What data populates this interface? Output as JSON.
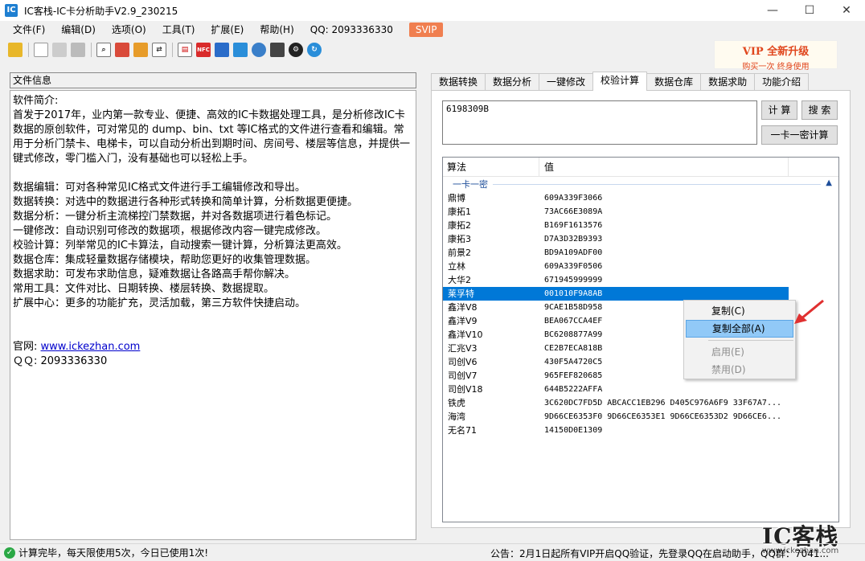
{
  "window": {
    "title": "IC客栈-IC卡分析助手V2.9_230215",
    "minimize": "—",
    "maximize": "☐",
    "close": "✕"
  },
  "menu": {
    "items": [
      "文件(F)",
      "编辑(D)",
      "选项(O)",
      "工具(T)",
      "扩展(E)",
      "帮助(H)"
    ],
    "qq": "QQ:  2093336330",
    "svip": "SVIP"
  },
  "vip_banner": {
    "line1": "VIP  全新升级",
    "line2": "购买一次      终身使用"
  },
  "left": {
    "header": "文件信息",
    "paragraphs": [
      "软件简介:",
      "首发于2017年，业内第一款专业、便捷、高效的IC卡数据处理工具，是分析修改IC卡数据的原创软件，可对常见的 dump、bin、txt 等IC格式的文件进行查看和编辑。常用于分析门禁卡、电梯卡，可以自动分析出到期时间、房间号、楼层等信息，并提供一键式修改，零门槛入门，没有基础也可以轻松上手。",
      "",
      "数据编辑：可对各种常见IC格式文件进行手工编辑修改和导出。",
      "数据转换：对选中的数据进行各种形式转换和简单计算，分析数据更便捷。",
      "数据分析：一键分析主流梯控门禁数据，并对各数据项进行着色标记。",
      "一键修改：自动识别可修改的数据项，根据修改内容一键完成修改。",
      "校验计算：列举常见的IC卡算法，自动搜索一键计算，分析算法更高效。",
      "数据仓库：集成轻量数据存储模块，帮助您更好的收集管理数据。",
      "数据求助：可发布求助信息，疑难数据让各路高手帮你解决。",
      "常用工具：文件对比、日期转换、楼层转换、数据提取。",
      "扩展中心：更多的功能扩充，灵活加载，第三方软件快捷启动。",
      "",
      ""
    ],
    "website_label": "官网: ",
    "website_url": "www.ickezhan.com",
    "qq_line": "ＱＱ: 2093336330"
  },
  "tabs": [
    "数据转换",
    "数据分析",
    "一键修改",
    "校验计算",
    "数据仓库",
    "数据求助",
    "功能介绍"
  ],
  "active_tab": 3,
  "calc": {
    "input_value": "6198309B",
    "btn_calc": "计 算",
    "btn_search": "搜 索",
    "btn_onecard": "一卡一密计算"
  },
  "results": {
    "col_algo": "算法",
    "col_value": "值",
    "group": "一卡一密",
    "rows": [
      {
        "name": "鼎博",
        "value": "609A339F3066"
      },
      {
        "name": "康拓1",
        "value": "73AC66E3089A"
      },
      {
        "name": "康拓2",
        "value": "B169F1613576"
      },
      {
        "name": "康拓3",
        "value": "D7A3D32B9393"
      },
      {
        "name": "前景2",
        "value": "BD9A109ADF00"
      },
      {
        "name": "立林",
        "value": "609A339F0506"
      },
      {
        "name": "大华2",
        "value": "671945999999"
      },
      {
        "name": "莱孚特",
        "value": "001010F9A8AB"
      },
      {
        "name": "鑫洋V8",
        "value": "9CAE1B58D958"
      },
      {
        "name": "鑫洋V9",
        "value": "BEA067CCA4EF"
      },
      {
        "name": "鑫洋V10",
        "value": "BC6208877A99"
      },
      {
        "name": "汇兆V3",
        "value": "CE2B7ECA818B"
      },
      {
        "name": "司创V6",
        "value": "430F5A4720C5"
      },
      {
        "name": "司创V7",
        "value": "965FEF820685"
      },
      {
        "name": "司创V18",
        "value": "644B5222AFFA"
      },
      {
        "name": "铁虎",
        "value": "3C620DC7FD5D ABCACC1EB296 D405C976A6F9 33F67A7..."
      },
      {
        "name": "海湾",
        "value": "9D66CE6353F0 9D66CE6353E1 9D66CE6353D2 9D66CE6..."
      },
      {
        "name": "无名71",
        "value": "14150D0E1309"
      }
    ],
    "selected_index": 7
  },
  "context_menu": {
    "copy": "复制(C)",
    "copy_all": "复制全部(A)",
    "enable": "启用(E)",
    "disable": "禁用(D)"
  },
  "status": {
    "left": "计算完毕，每天限使用5次，今日已使用1次!",
    "notice": "公告：2月1日起所有VIP开启QQ验证，先登录QQ在启动助手，QQ群：7041..."
  },
  "watermark": {
    "logo": "IC客栈",
    "url": "www.ickezhan.com"
  },
  "colors": {
    "accent": "#0078d7",
    "svip": "#f07f50",
    "vip_text": "#e0461d",
    "status_ok": "#2aa845"
  }
}
